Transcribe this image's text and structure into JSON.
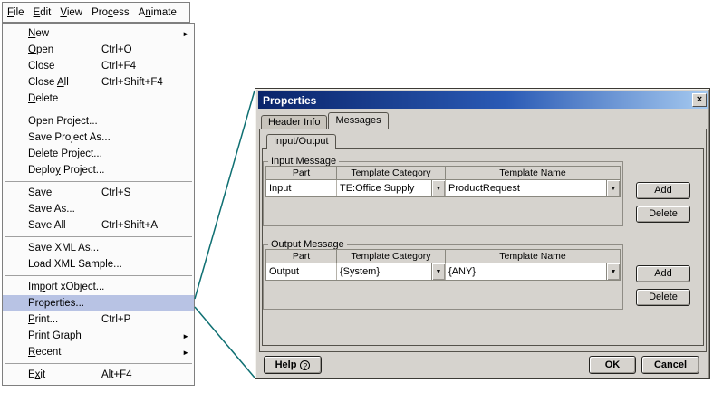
{
  "icons": {
    "close": "×",
    "submenu_arrow": "►",
    "dropdown_arrow": "▼",
    "help": "?"
  },
  "colors": {
    "menu_selection": "#b8c3e4",
    "titlebar_gradient_start": "#0a246a",
    "titlebar_gradient_end": "#a6caf0",
    "dialog_background": "#d6d3ce",
    "callout_line": "#0e6f72"
  },
  "menubar": {
    "items": [
      {
        "label": "File",
        "mnemonic": "F"
      },
      {
        "label": "Edit",
        "mnemonic": "E"
      },
      {
        "label": "View",
        "mnemonic": "V"
      },
      {
        "label": "Process",
        "mnemonic": "c"
      },
      {
        "label": "Animate",
        "mnemonic": "n"
      }
    ]
  },
  "file_menu": {
    "items": [
      {
        "label": "New",
        "mnemonic": "N",
        "submenu": true
      },
      {
        "label": "Open",
        "mnemonic": "O",
        "shortcut": "Ctrl+O"
      },
      {
        "label": "Close",
        "shortcut": "Ctrl+F4"
      },
      {
        "label": "Close All",
        "mnemonic": "A",
        "shortcut": "Ctrl+Shift+F4"
      },
      {
        "label": "Delete",
        "mnemonic": "D",
        "separator_after": true
      },
      {
        "label": "Open Project..."
      },
      {
        "label": "Save Project As..."
      },
      {
        "label": "Delete Project..."
      },
      {
        "label": "Deploy Project...",
        "mnemonic": "y",
        "separator_after": true
      },
      {
        "label": "Save",
        "shortcut": "Ctrl+S"
      },
      {
        "label": "Save As..."
      },
      {
        "label": "Save All",
        "shortcut": "Ctrl+Shift+A",
        "separator_after": true
      },
      {
        "label": "Save XML As..."
      },
      {
        "label": "Load XML Sample...",
        "separator_after": true
      },
      {
        "label": "Import xObject...",
        "mnemonic": "p"
      },
      {
        "label": "Properties...",
        "selected": true
      },
      {
        "label": "Print...",
        "mnemonic": "P",
        "shortcut": "Ctrl+P"
      },
      {
        "label": "Print Graph",
        "submenu": true
      },
      {
        "label": "Recent",
        "mnemonic": "R",
        "submenu": true,
        "separator_after": true
      },
      {
        "label": "Exit",
        "mnemonic": "x",
        "shortcut": "Alt+F4"
      }
    ]
  },
  "dialog": {
    "title": "Properties",
    "tabs": [
      {
        "label": "Header Info",
        "active": false
      },
      {
        "label": "Messages",
        "active": true
      }
    ],
    "inner_tabs": [
      {
        "label": "Input/Output",
        "active": true
      }
    ],
    "input_message": {
      "group_label": "Input Message",
      "columns": [
        "Part",
        "Template Category",
        "Template Name"
      ],
      "rows": [
        {
          "part": "Input",
          "template_category": "TE:Office Supply",
          "template_name": "ProductRequest"
        }
      ],
      "buttons": [
        "Add",
        "Delete"
      ]
    },
    "output_message": {
      "group_label": "Output Message",
      "columns": [
        "Part",
        "Template Category",
        "Template Name"
      ],
      "rows": [
        {
          "part": "Output",
          "template_category": "{System}",
          "template_name": "{ANY}"
        }
      ],
      "buttons": [
        "Add",
        "Delete"
      ]
    },
    "footer": {
      "help_label": "Help",
      "ok_label": "OK",
      "cancel_label": "Cancel"
    }
  }
}
